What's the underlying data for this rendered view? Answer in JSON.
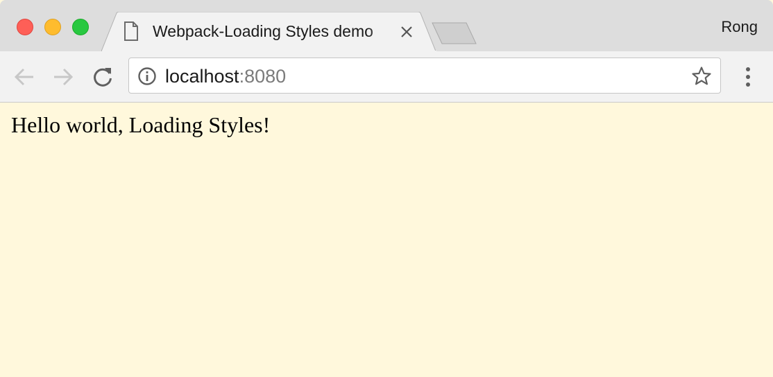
{
  "browser": {
    "tab": {
      "title": "Webpack-Loading Styles demo",
      "icon": "document-icon"
    },
    "profile_name": "Rong",
    "address_bar": {
      "host": "localhost",
      "port": ":8080"
    },
    "icons": {
      "back": "arrow-left-icon",
      "forward": "arrow-right-icon",
      "reload": "reload-icon",
      "info": "info-icon",
      "bookmark": "star-icon",
      "menu": "vertical-dots-icon",
      "close_tab": "close-icon"
    },
    "colors": {
      "titlebar": "#dddddd",
      "toolbar": "#f2f2f2",
      "page_background": "#fff8dc"
    }
  },
  "page": {
    "text": "Hello world, Loading Styles!"
  }
}
